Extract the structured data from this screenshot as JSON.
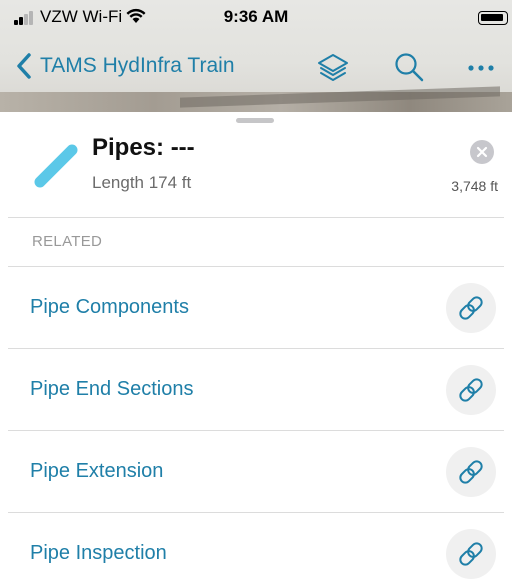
{
  "status_bar": {
    "carrier": "VZW Wi-Fi",
    "time": "9:36 AM",
    "icons": [
      "signal-icon",
      "wifi-icon",
      "battery-icon"
    ]
  },
  "nav": {
    "back_label": "TAMS HydInfra Train",
    "icons": [
      "chevron-left-icon",
      "layers-icon",
      "search-icon",
      "more-icon"
    ]
  },
  "feature": {
    "title": "Pipes: ---",
    "subtitle": "Length 174 ft",
    "distance": "3,748 ft",
    "icons": [
      "pipe-icon",
      "close-icon"
    ]
  },
  "related": {
    "header": "RELATED",
    "items": [
      {
        "label": "Pipe Components",
        "icon": "link-icon"
      },
      {
        "label": "Pipe End Sections",
        "icon": "link-icon"
      },
      {
        "label": "Pipe Extension",
        "icon": "link-icon"
      },
      {
        "label": "Pipe Inspection",
        "icon": "link-icon"
      }
    ]
  },
  "colors": {
    "accent": "#1f7fa8",
    "pipe": "#5bc8e8",
    "secondary_text": "#6b6b6b"
  }
}
